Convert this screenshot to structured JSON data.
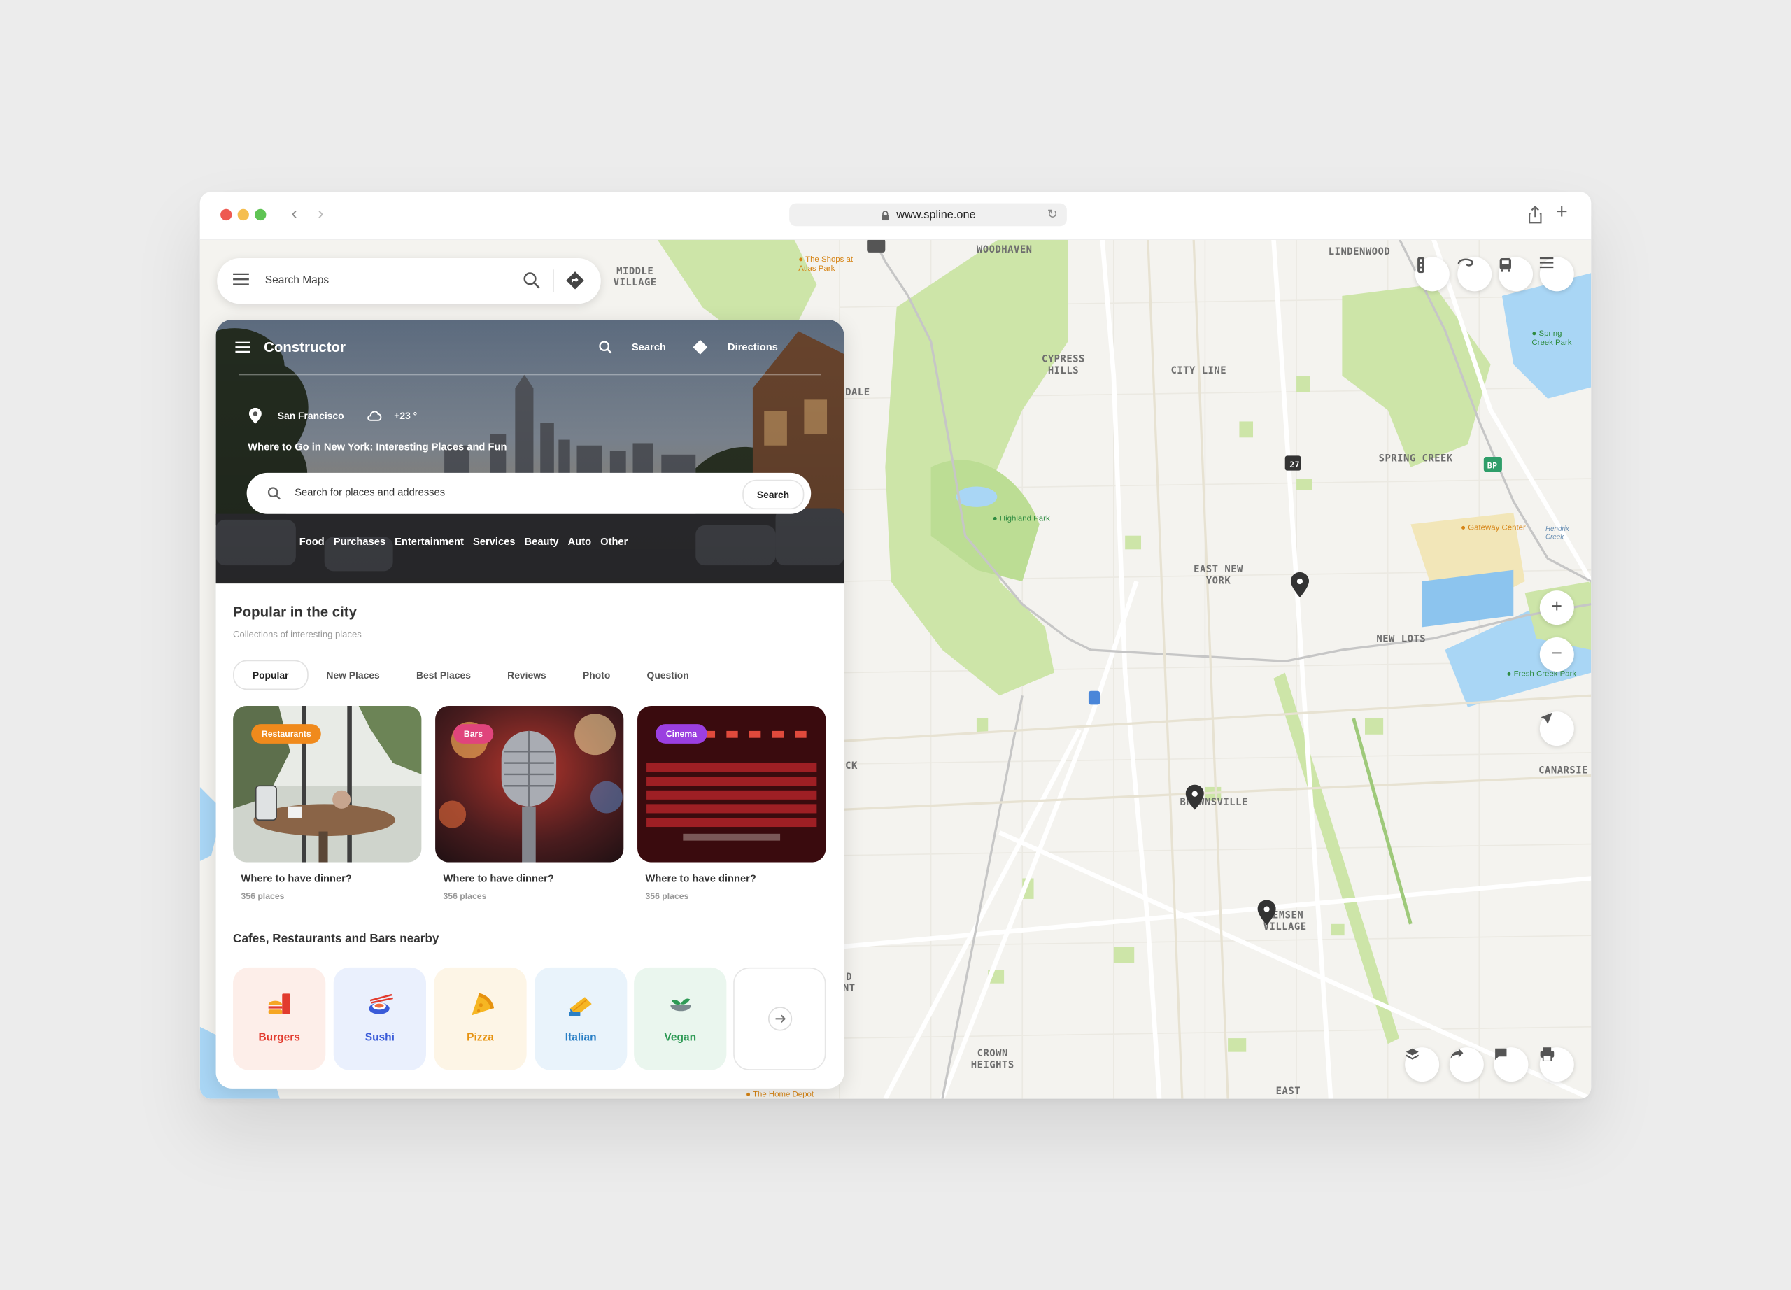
{
  "browser": {
    "url": "www.spline.one",
    "colors": {
      "close": "#ee5a52",
      "minimize": "#f5be4f",
      "maximize": "#5fc454"
    }
  },
  "map_search": {
    "placeholder": "Search Maps"
  },
  "map_labels": [
    {
      "id": "middle-village",
      "text": "MIDDLE\nVILLAGE"
    },
    {
      "id": "woodhaven",
      "text": "WOODHAVEN"
    },
    {
      "id": "lindenwood",
      "text": "LINDENWOOD"
    },
    {
      "id": "cypress-hills",
      "text": "CYPRESS\nHILLS"
    },
    {
      "id": "city-line",
      "text": "CITY LINE"
    },
    {
      "id": "spring-creek",
      "text": "SPRING CREEK"
    },
    {
      "id": "east-new-york",
      "text": "EAST NEW\nYORK"
    },
    {
      "id": "new-lots",
      "text": "NEW LOTS"
    },
    {
      "id": "canarsie",
      "text": "CANARSIE"
    },
    {
      "id": "brownsville",
      "text": "BROWNSVILLE"
    },
    {
      "id": "remsen-village",
      "text": "REMSEN\nVILLAGE"
    },
    {
      "id": "crown-heights",
      "text": "CROWN\nHEIGHTS"
    },
    {
      "id": "east",
      "text": "EAST"
    },
    {
      "id": "dale",
      "text": "DALE"
    },
    {
      "id": "ck",
      "text": "CK"
    },
    {
      "id": "ont",
      "text": "D\nNT"
    }
  ],
  "map_pois": [
    {
      "id": "shops-atlas",
      "text": "The Shops at\nAtlas Park"
    },
    {
      "id": "highland-park",
      "text": "Highland Park"
    },
    {
      "id": "spring-creek-park",
      "text": "Spring\nCreek Park"
    },
    {
      "id": "gateway-center",
      "text": "Gateway Center"
    },
    {
      "id": "hendrix-creek",
      "text": "Hendrix\nCreek"
    },
    {
      "id": "fresh-creek-park",
      "text": "Fresh Creek Park"
    },
    {
      "id": "home-depot",
      "text": "The Home Depot"
    }
  ],
  "map_shields": {
    "route27": "27",
    "bp": "BP"
  },
  "panel": {
    "title": "Constructor",
    "nav": {
      "search": "Search",
      "directions": "Directions"
    },
    "location": "San Francisco",
    "weather": "+23 °",
    "headline": "Where to Go in New York: Interesting Places and Fun",
    "search": {
      "placeholder": "Search for places and addresses",
      "button": "Search"
    },
    "categories": [
      "Food",
      "Purchases",
      "Entertainment",
      "Services",
      "Beauty",
      "Auto",
      "Other"
    ],
    "popular": {
      "title": "Popular in the city",
      "subtitle": "Collections of interesting places",
      "tabs": [
        "Popular",
        "New Places",
        "Best Places",
        "Reviews",
        "Photo",
        "Question"
      ],
      "cards": [
        {
          "badge": "Restaurants",
          "badge_color": "#f08a1c",
          "title": "Where to have dinner?",
          "count": "356 places"
        },
        {
          "badge": "Bars",
          "badge_color": "#e0447c",
          "title": "Where to have dinner?",
          "count": "356 places"
        },
        {
          "badge": "Cinema",
          "badge_color": "#9b3fe0",
          "title": "Where to have dinner?",
          "count": "356 places"
        }
      ]
    },
    "nearby": {
      "title": "Cafes, Restaurants and Bars nearby",
      "items": [
        {
          "label": "Burgers",
          "icon": "burger-icon",
          "bg": "#fdeee9",
          "color": "#e23b2e"
        },
        {
          "label": "Sushi",
          "icon": "sushi-icon",
          "bg": "#eaf0fd",
          "color": "#3a5bd8"
        },
        {
          "label": "Pizza",
          "icon": "pizza-icon",
          "bg": "#fdf5e6",
          "color": "#e6920f"
        },
        {
          "label": "Italian",
          "icon": "italian-icon",
          "bg": "#e9f3fb",
          "color": "#2a7fc5"
        },
        {
          "label": "Vegan",
          "icon": "vegan-icon",
          "bg": "#eaf6ee",
          "color": "#2e9a55"
        }
      ]
    }
  }
}
